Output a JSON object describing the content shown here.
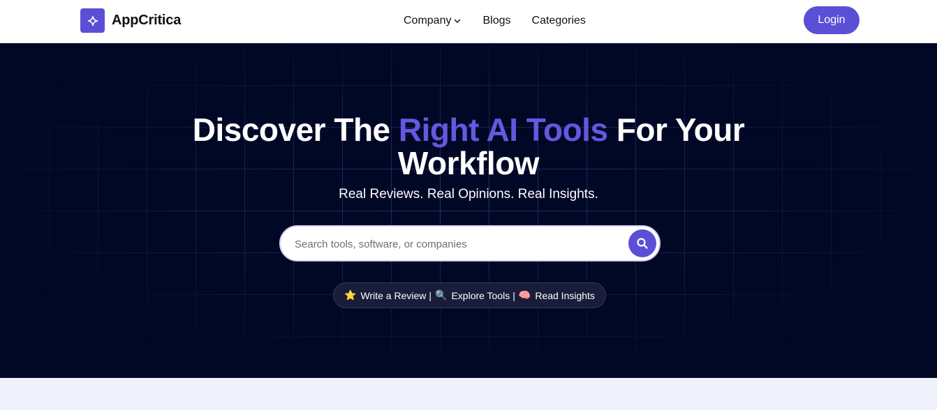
{
  "navbar": {
    "brand_name": "AppCritica",
    "links": [
      {
        "label": "Company"
      },
      {
        "label": "Blogs"
      },
      {
        "label": "Categories"
      }
    ],
    "login_label": "Login"
  },
  "hero": {
    "title_before": "Discover The",
    "title_accent": "Right AI Tools",
    "title_after": "For Your Workflow",
    "subtitle": "Real Reviews. Real Opinions. Real Insights.",
    "search": {
      "placeholder": "Search tools, software, or companies",
      "value": ""
    },
    "quick_links": [
      {
        "emoji": "⭐",
        "label": "Write a Review"
      },
      {
        "emoji": "🔍",
        "label": "Explore Tools"
      },
      {
        "emoji": "🧠",
        "label": "Read Insights"
      }
    ],
    "separator": "|"
  },
  "colors": {
    "accent": "#5b4fd6",
    "hero_bg": "#000826",
    "title_accent": "#6657e0"
  }
}
